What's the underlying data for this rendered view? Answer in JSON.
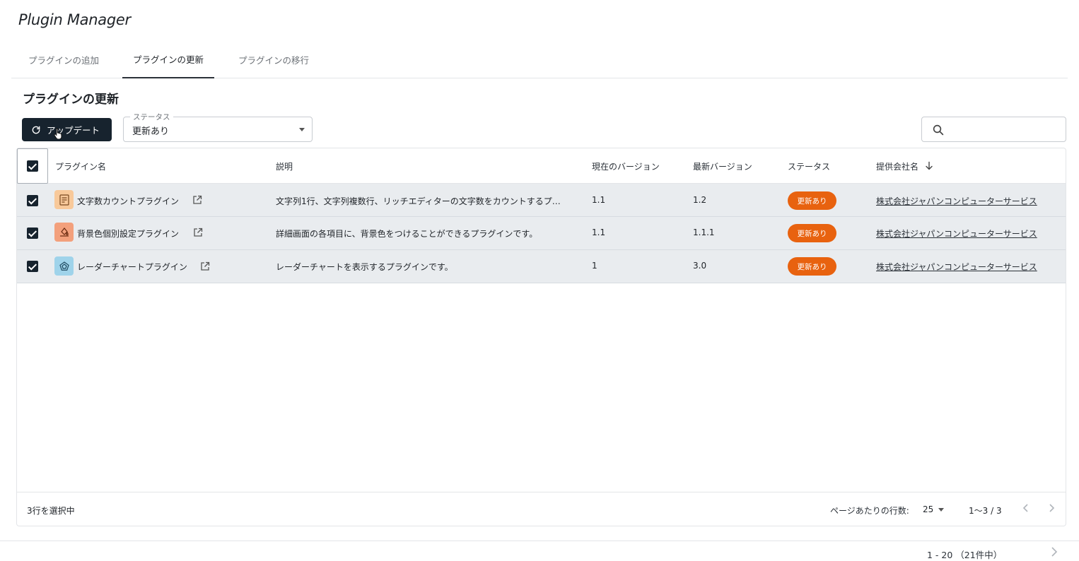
{
  "app": {
    "title": "Plugin Manager"
  },
  "tabs": [
    {
      "label": "プラグインの追加",
      "active": false
    },
    {
      "label": "プラグインの更新",
      "active": true
    },
    {
      "label": "プラグインの移行",
      "active": false
    }
  ],
  "section": {
    "title": "プラグインの更新"
  },
  "toolbar": {
    "update_label": "アップデート",
    "status_filter_label": "ステータス",
    "status_filter_value": "更新あり",
    "search_placeholder": ""
  },
  "table": {
    "columns": {
      "name": "プラグイン名",
      "description": "説明",
      "current_version": "現在のバージョン",
      "latest_version": "最新バージョン",
      "status": "ステータス",
      "vendor": "提供会社名"
    },
    "sort": {
      "column": "vendor",
      "direction": "descending",
      "icon": "arrow-down-icon"
    },
    "rows": [
      {
        "selected": true,
        "icon": "character-count-icon",
        "icon_color": "#f8c99a",
        "name": "文字数カウントプラグイン",
        "description": "文字列1行、文字列複数行、リッチエディターの文字数をカウントするプ…",
        "current_version": "1.1",
        "latest_version": "1.2",
        "status": "更新あり",
        "vendor": "株式会社ジャパンコンピューターサービス"
      },
      {
        "selected": true,
        "icon": "paint-bucket-icon",
        "icon_color": "#f3a07c",
        "name": "背景色個別設定プラグイン",
        "description": "詳細画面の各項目に、背景色をつけることができるプラグインです。",
        "current_version": "1.1",
        "latest_version": "1.1.1",
        "status": "更新あり",
        "vendor": "株式会社ジャパンコンピューターサービス"
      },
      {
        "selected": true,
        "icon": "radar-chart-icon",
        "icon_color": "#9fd3ea",
        "name": "レーダーチャートプラグイン",
        "description": "レーダーチャートを表示するプラグインです。",
        "current_version": "1",
        "latest_version": "3.0",
        "status": "更新あり",
        "vendor": "株式会社ジャパンコンピューターサービス"
      }
    ]
  },
  "footer": {
    "selected_count": "3行を選択中",
    "rows_per_page_label": "ページあたりの行数:",
    "rows_per_page_value": "25",
    "range": "1〜3 / 3"
  },
  "bottom_bar": {
    "range": "1 - 20 （21件中）"
  },
  "colors": {
    "primary_dark": "#17232e",
    "status_badge": "#e8620f",
    "row_selected": "#e9ecef"
  }
}
